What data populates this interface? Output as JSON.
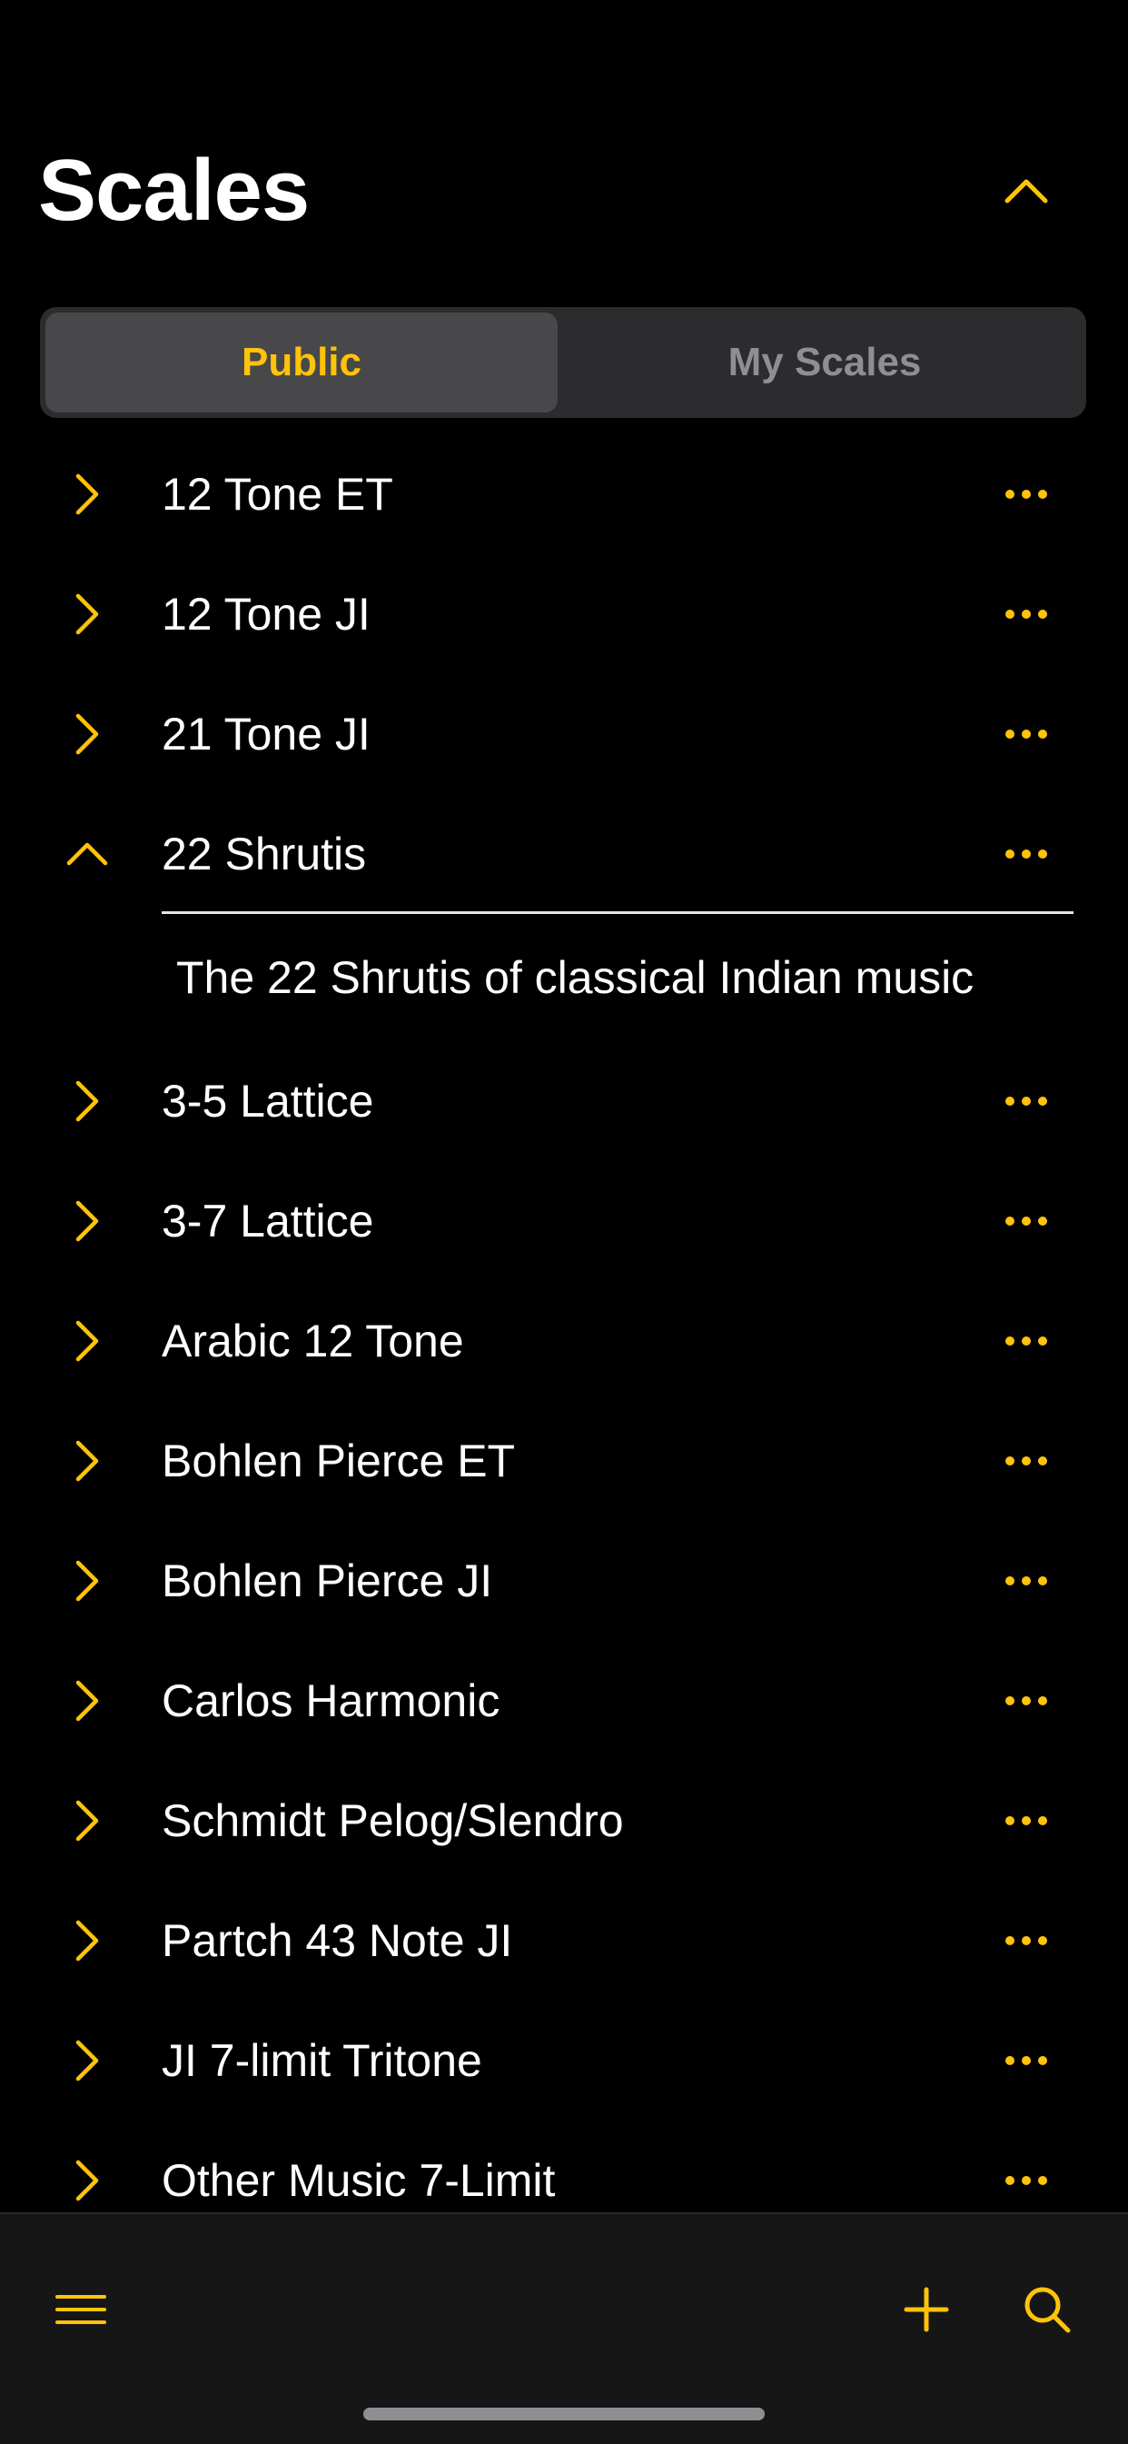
{
  "theme": {
    "accent": "#FFC30A",
    "background": "#000000",
    "text": "#FFFFFF",
    "segment_inactive_text": "#8E8E93"
  },
  "header": {
    "title": "Scales",
    "collapse_icon": "chevron-up-icon"
  },
  "segments": {
    "selected": "Public",
    "items": [
      {
        "label": "Public"
      },
      {
        "label": "My Scales"
      }
    ]
  },
  "scales": [
    {
      "name": "12 Tone ET"
    },
    {
      "name": "12 Tone JI"
    },
    {
      "name": "21 Tone JI"
    },
    {
      "name": "22 Shrutis",
      "description": "The 22 Shrutis of classical Indian music"
    },
    {
      "name": "3-5 Lattice"
    },
    {
      "name": "3-7 Lattice"
    },
    {
      "name": "Arabic 12 Tone"
    },
    {
      "name": "Bohlen Pierce ET"
    },
    {
      "name": "Bohlen Pierce JI"
    },
    {
      "name": "Carlos Harmonic"
    },
    {
      "name": "Schmidt Pelog/Slendro"
    },
    {
      "name": "Partch 43 Note JI"
    },
    {
      "name": "JI 7-limit Tritone"
    },
    {
      "name": "Other Music 7-Limit"
    }
  ],
  "tabbar": {
    "menu_icon": "hamburger-menu-icon",
    "add_icon": "plus-icon",
    "search_icon": "search-icon"
  }
}
